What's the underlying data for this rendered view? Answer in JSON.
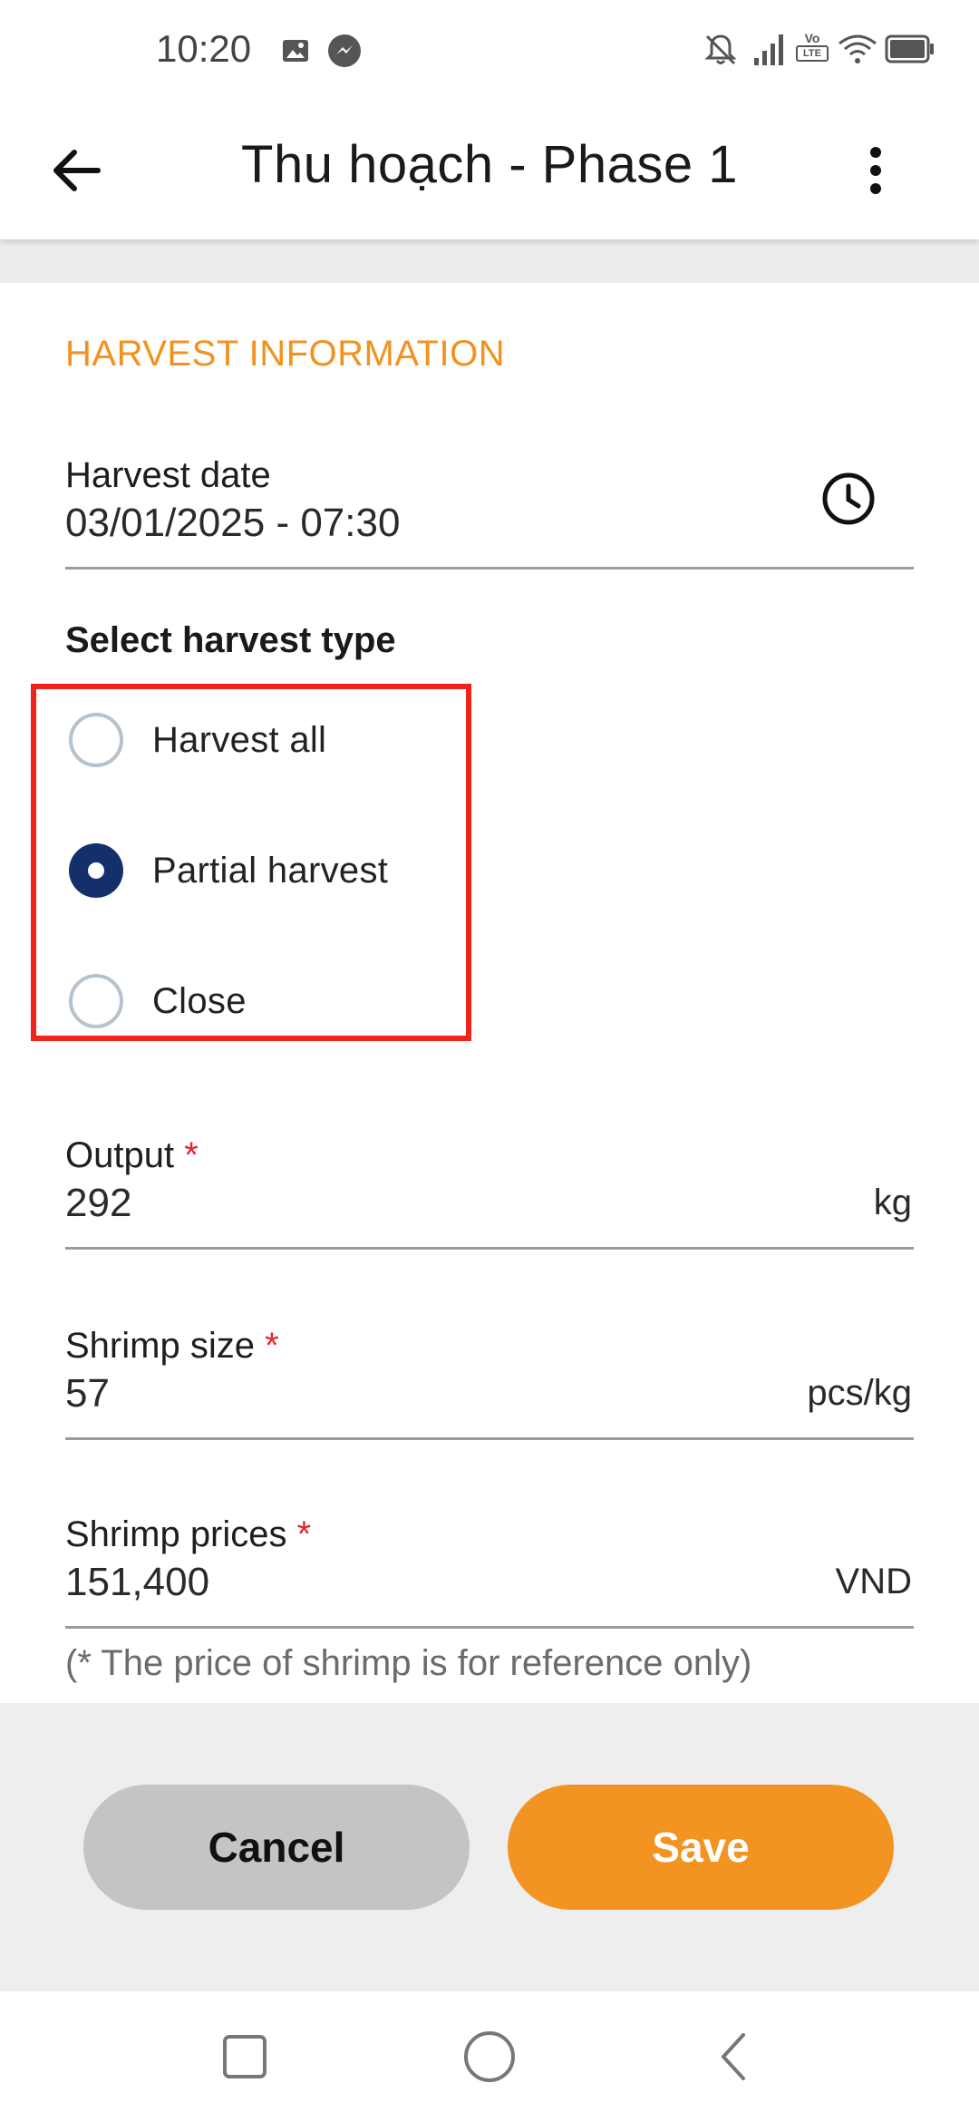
{
  "status_bar": {
    "time": "10:20",
    "icons": [
      "image-icon",
      "messenger-icon",
      "bell-off-icon",
      "signal-icon",
      "volte-icon",
      "wifi-icon",
      "battery-icon"
    ],
    "volte_text": "Vo LTE"
  },
  "app_bar": {
    "title": "Thu hoạch  - Phase 1",
    "back_icon": "arrow-left-icon",
    "more_icon": "more-vert-icon"
  },
  "section": {
    "title": "HARVEST INFORMATION"
  },
  "harvest_date": {
    "label": "Harvest date",
    "value": "03/01/2025 - 07:30",
    "icon": "clock-icon"
  },
  "harvest_type": {
    "heading": "Select harvest type",
    "options": [
      {
        "label": "Harvest all",
        "checked": false
      },
      {
        "label": "Partial harvest",
        "checked": true
      },
      {
        "label": "Close",
        "checked": false
      }
    ]
  },
  "output": {
    "label": "Output",
    "required_mark": "*",
    "value": "292",
    "unit": "kg"
  },
  "shrimp_size": {
    "label": "Shrimp size",
    "required_mark": "*",
    "value": "57",
    "unit": "pcs/kg"
  },
  "shrimp_prices": {
    "label": "Shrimp prices",
    "required_mark": "*",
    "value": "151,400",
    "unit": "VND"
  },
  "note": "(* The price of shrimp is for reference only)",
  "actions": {
    "cancel_label": "Cancel",
    "save_label": "Save"
  },
  "colors": {
    "accent": "#f2921e",
    "radio_checked": "#14306b",
    "highlight": "#f2231b",
    "save": "#f39322"
  },
  "system_nav": [
    "square-icon",
    "circle-icon",
    "chevron-left-icon"
  ]
}
